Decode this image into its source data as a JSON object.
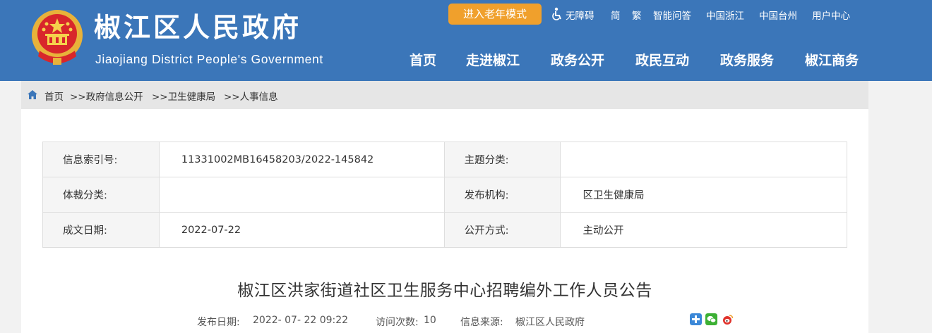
{
  "header": {
    "title": "椒江区人民政府",
    "subtitle": "Jiaojiang District People's Government",
    "elder_mode": "进入老年模式",
    "toplinks": [
      "无障碍",
      "简",
      "繁",
      "智能问答",
      "中国浙江",
      "中国台州",
      "用户中心"
    ],
    "nav": [
      "首页",
      "走进椒江",
      "政务公开",
      "政民互动",
      "政务服务",
      "椒江商务"
    ]
  },
  "breadcrumb": [
    "首页",
    ">>政府信息公开",
    ">>卫生健康局",
    ">>人事信息"
  ],
  "info": {
    "index_label": "信息索引号:",
    "index_value": "11331002MB16458203/2022-145842",
    "topic_label": "主题分类:",
    "topic_value": "",
    "genre_label": "体裁分类:",
    "genre_value": "",
    "org_label": "发布机构:",
    "org_value": "区卫生健康局",
    "date_label": "成文日期:",
    "date_value": "2022-07-22",
    "open_label": "公开方式:",
    "open_value": "主动公开"
  },
  "article": {
    "title": "椒江区洪家街道社区卫生服务中心招聘编外工作人员公告",
    "publish_label": "发布日期:",
    "publish_value": "2022- 07- 22 09:22",
    "visits_label": "访问次数:",
    "visits_value": "10",
    "source_label": "信息来源:",
    "source_value": "椒江区人民政府"
  },
  "colors": {
    "header_bg": "#3b76b9",
    "elder_btn": "#f0a02c",
    "share_plus": "#3b88d8",
    "share_wechat": "#3cb034",
    "share_weibo": "#e0322b"
  },
  "icons": [
    "national-emblem",
    "accessibility-icon",
    "home-icon",
    "share-plus-icon",
    "wechat-icon",
    "weibo-icon"
  ]
}
